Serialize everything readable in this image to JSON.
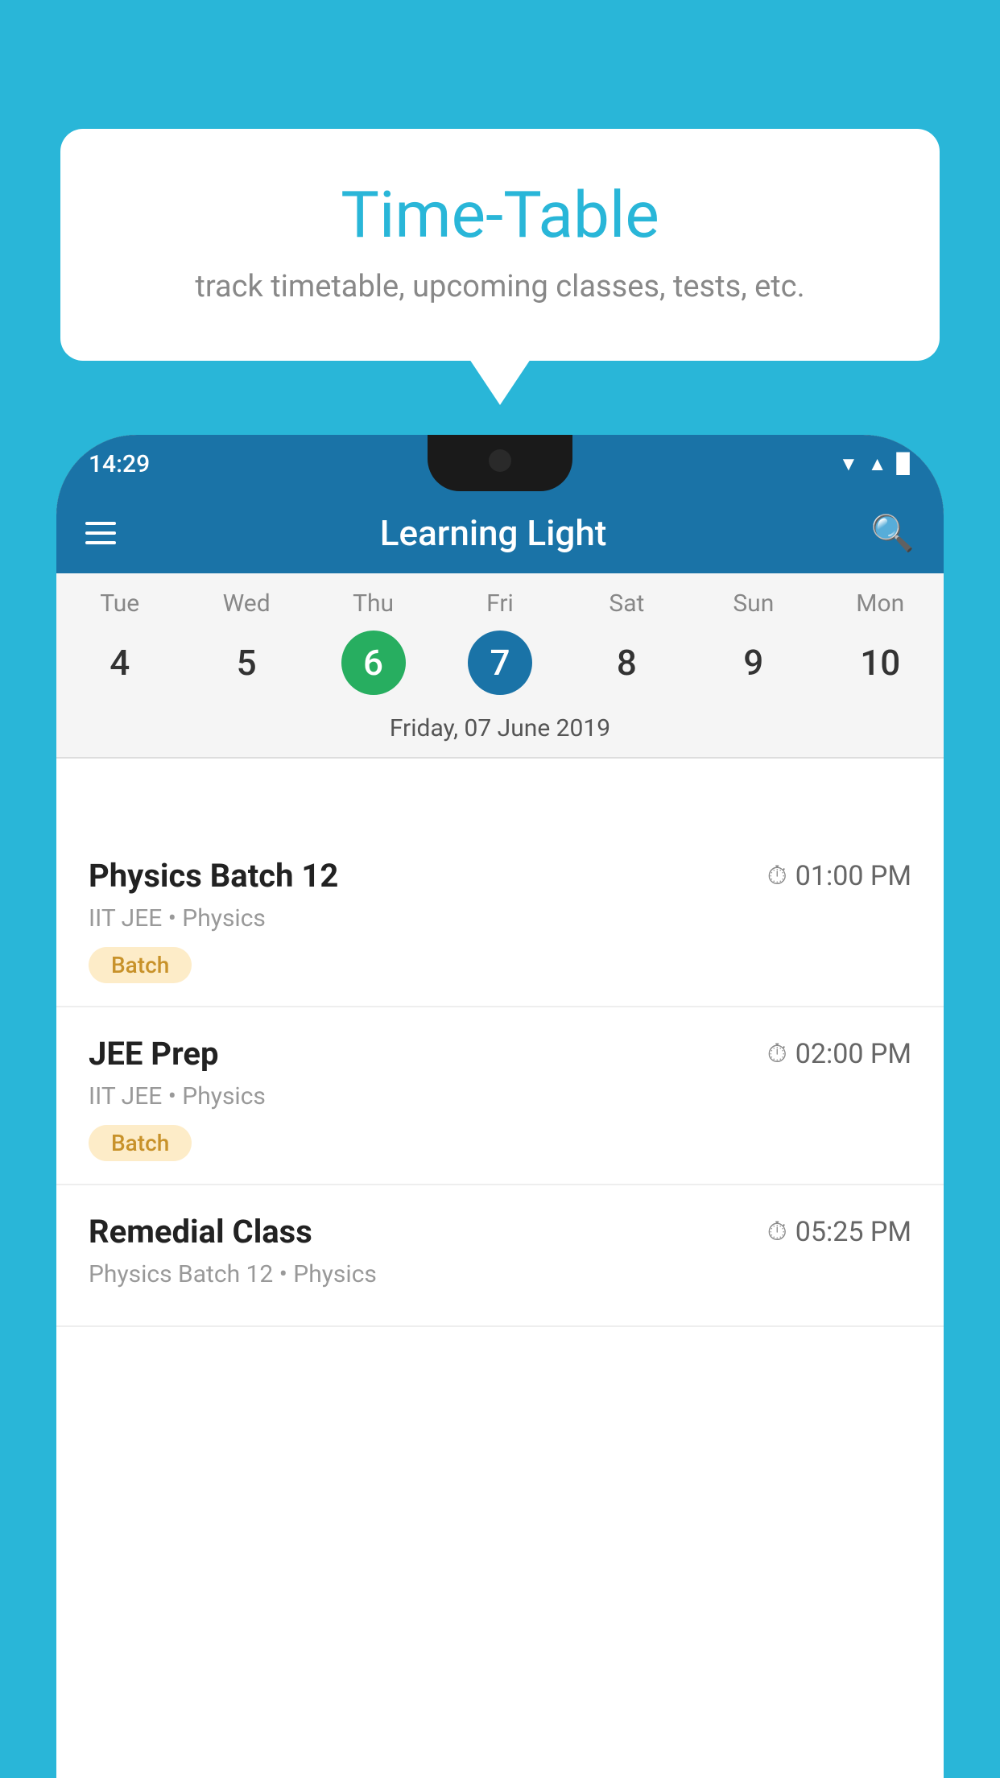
{
  "background": {
    "color": "#29b6d8"
  },
  "speech_bubble": {
    "title": "Time-Table",
    "subtitle": "track timetable, upcoming classes, tests, etc."
  },
  "status_bar": {
    "time": "14:29",
    "icons": [
      "▲",
      "▲",
      "▉"
    ]
  },
  "app_bar": {
    "title": "Learning Light",
    "hamburger_label": "menu",
    "search_label": "search"
  },
  "calendar": {
    "days": [
      {
        "name": "Tue",
        "num": "4",
        "state": "normal"
      },
      {
        "name": "Wed",
        "num": "5",
        "state": "normal"
      },
      {
        "name": "Thu",
        "num": "6",
        "state": "today"
      },
      {
        "name": "Fri",
        "num": "7",
        "state": "selected"
      },
      {
        "name": "Sat",
        "num": "8",
        "state": "normal"
      },
      {
        "name": "Sun",
        "num": "9",
        "state": "normal"
      },
      {
        "name": "Mon",
        "num": "10",
        "state": "normal"
      }
    ],
    "selected_date_label": "Friday, 07 June 2019"
  },
  "schedule_items": [
    {
      "title": "Physics Batch 12",
      "time": "01:00 PM",
      "subtitle": "IIT JEE • Physics",
      "badge": "Batch"
    },
    {
      "title": "JEE Prep",
      "time": "02:00 PM",
      "subtitle": "IIT JEE • Physics",
      "badge": "Batch"
    },
    {
      "title": "Remedial Class",
      "time": "05:25 PM",
      "subtitle": "Physics Batch 12 • Physics",
      "badge": null
    }
  ]
}
